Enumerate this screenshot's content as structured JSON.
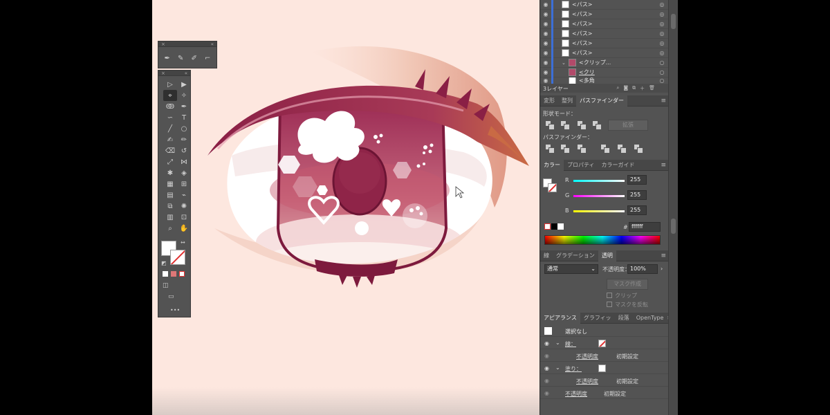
{
  "layers": {
    "rows": [
      {
        "name": "<パス>"
      },
      {
        "name": "<パス>"
      },
      {
        "name": "<パス>"
      },
      {
        "name": "<パス>"
      },
      {
        "name": "<パス>"
      },
      {
        "name": "<パス>"
      },
      {
        "name": "<クリップ..."
      },
      {
        "name": "<クリ"
      },
      {
        "name": "<多角"
      }
    ],
    "count_label": "3レイヤー"
  },
  "pathfinder": {
    "tabs": [
      "変形",
      "整列",
      "パスファインダー"
    ],
    "shape_modes_label": "形状モード：",
    "expand_button": "拡張",
    "pathfinders_label": "パスファインダー："
  },
  "color": {
    "tabs": [
      "カラー",
      "プロパティ",
      "カラーガイド"
    ],
    "r_label": "R",
    "g_label": "G",
    "b_label": "B",
    "r": "255",
    "g": "255",
    "b": "255",
    "hex_label": "#",
    "hex": "ffffff"
  },
  "transparency": {
    "tabs": [
      "線",
      "グラデーション",
      "透明"
    ],
    "blend_mode": "通常",
    "opacity_label": "不透明度：",
    "opacity": "100%",
    "make_mask": "マスク作成",
    "clip": "クリップ",
    "invert_mask": "マスクを反転"
  },
  "appearance": {
    "tabs": [
      "アピアランス",
      "グラフィッ",
      "段落",
      "OpenType"
    ],
    "selection": "選択なし",
    "stroke_label": "線：",
    "fill_label": "塗り：",
    "opacity_label": "不透明度",
    "default": "初期設定"
  },
  "colors": {
    "panel_bg": "#535353",
    "canvas_bg": "#fde7df",
    "iris": "#b24a6a",
    "lash": "#8a1f45",
    "layer_accent": "#3c6fd6"
  }
}
